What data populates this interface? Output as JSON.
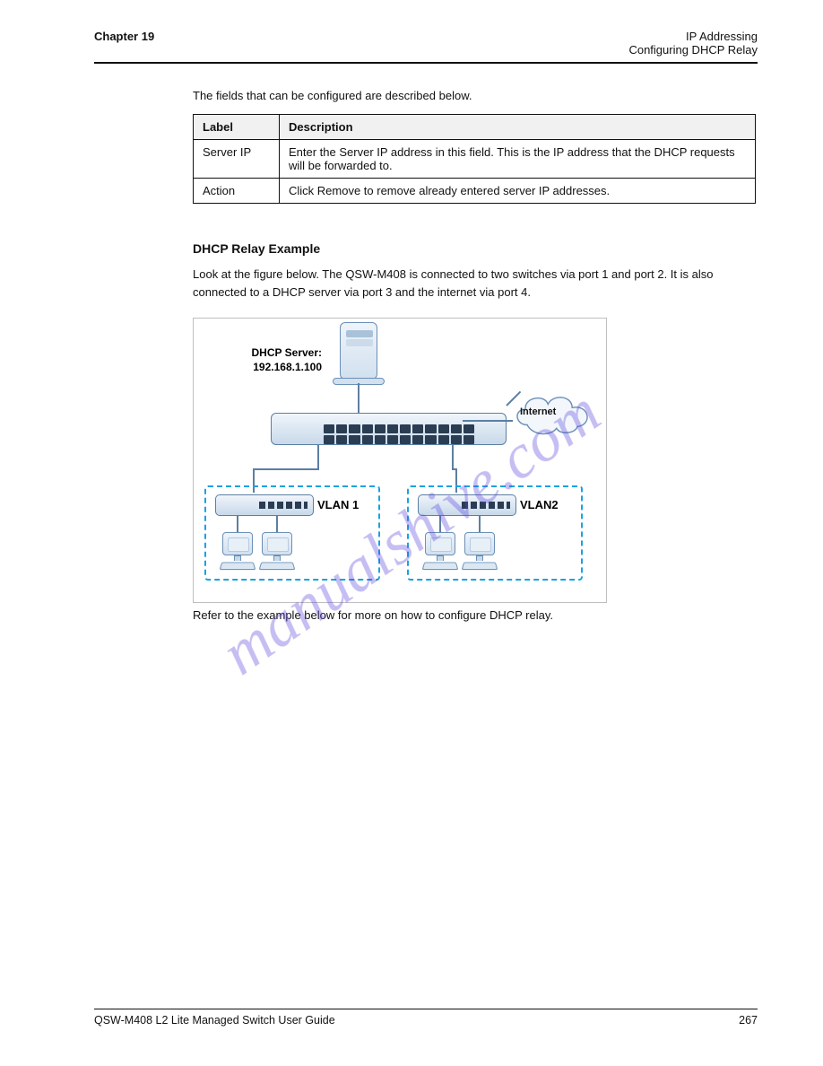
{
  "header": {
    "chapter": "Chapter 19",
    "topic": "IP Addressing",
    "subtopic": "Configuring DHCP Relay"
  },
  "intro": "The fields that can be configured are described below.",
  "table": {
    "headers": [
      "Label",
      "Description"
    ],
    "rows": [
      {
        "label": "Server IP",
        "desc": "Enter the Server IP address in this field. This is the IP address that the DHCP requests will be forwarded to."
      },
      {
        "label": "Action",
        "desc": "Click Remove to remove already entered server IP addresses."
      }
    ]
  },
  "example": {
    "heading": "DHCP Relay Example",
    "p1": "Look at the figure below. The QSW-M408 is connected to two switches via port 1 and port 2. It is also connected to a DHCP server via port 3 and the internet via port 4.",
    "note": "Refer to the example below for more on how to configure DHCP relay."
  },
  "diagram": {
    "server_label_l1": "DHCP Server:",
    "server_label_l2": "192.168.1.100",
    "cloud_label": "Internet",
    "vlan1_label": "VLAN 1",
    "vlan2_label": "VLAN2"
  },
  "watermark": "manualshive.com",
  "footer": {
    "guide": "QSW-M408 L2 Lite Managed Switch User Guide",
    "page": "267"
  }
}
